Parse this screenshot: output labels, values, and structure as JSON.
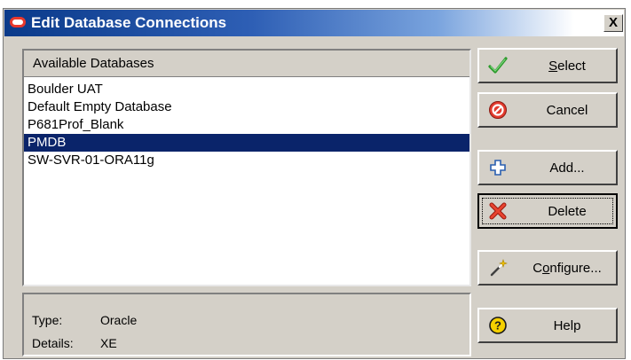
{
  "window": {
    "title": "Edit Database Connections",
    "close_label": "X"
  },
  "list": {
    "header": "Available Databases",
    "items": [
      {
        "label": "Boulder UAT",
        "selected": false
      },
      {
        "label": "Default Empty Database",
        "selected": false
      },
      {
        "label": "P681Prof_Blank",
        "selected": false
      },
      {
        "label": "PMDB",
        "selected": true
      },
      {
        "label": "SW-SVR-01-ORA11g",
        "selected": false
      }
    ]
  },
  "info": {
    "type_label": "Type:",
    "type_value": "Oracle",
    "details_label": "Details:",
    "details_value": "XE"
  },
  "buttons": {
    "select": {
      "mnemonic": "S",
      "rest": "elect",
      "icon": "checkmark-icon"
    },
    "cancel": {
      "label": "Cancel",
      "icon": "cancel-icon"
    },
    "add": {
      "label": "Add...",
      "icon": "plus-icon"
    },
    "delete": {
      "label": "Delete",
      "icon": "delete-x-icon"
    },
    "configure": {
      "mnemonic": "o",
      "prefix": "C",
      "rest": "nfigure...",
      "icon": "magic-wand-icon"
    },
    "help": {
      "label": "Help",
      "icon": "help-icon"
    }
  },
  "colors": {
    "selection": "#0a246a",
    "dialog_face": "#d4d0c8",
    "title_start": "#0a3a8a"
  }
}
